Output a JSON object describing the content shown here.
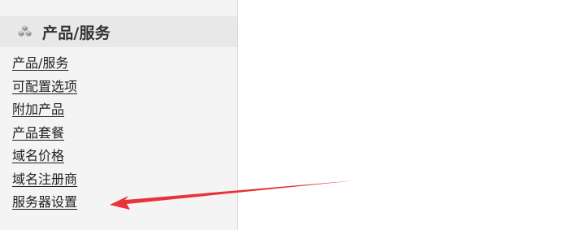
{
  "sidebar": {
    "header": {
      "title": "产品/服务",
      "icon": "cubes-icon"
    },
    "items": [
      {
        "label": "产品/服务"
      },
      {
        "label": "可配置选项"
      },
      {
        "label": "附加产品"
      },
      {
        "label": "产品套餐"
      },
      {
        "label": "域名价格"
      },
      {
        "label": "域名注册商"
      },
      {
        "label": "服务器设置"
      }
    ]
  },
  "annotation": {
    "type": "red-arrow",
    "color": "#e8333a"
  }
}
